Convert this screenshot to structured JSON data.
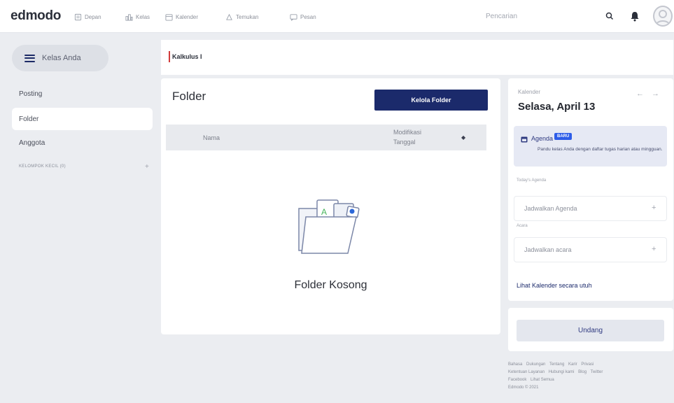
{
  "header": {
    "logo": "edmodo",
    "nav": [
      {
        "label": "Depan",
        "icon": "home-icon"
      },
      {
        "label": "Kelas",
        "icon": "class-icon"
      },
      {
        "label": "Kalender",
        "icon": "calendar-icon"
      },
      {
        "label": "Temukan",
        "icon": "discover-icon"
      },
      {
        "label": "Pesan",
        "icon": "message-icon"
      }
    ],
    "search_placeholder": "Pencarian"
  },
  "sidebar": {
    "class_toggle": "Kelas Anda",
    "items": [
      {
        "label": "Posting"
      },
      {
        "label": "Folder"
      },
      {
        "label": "Anggota"
      }
    ],
    "small_groups": "KELOMPOK KECIL (0)"
  },
  "class_banner": {
    "title": "Kalkulus I"
  },
  "folder": {
    "title": "Folder",
    "manage_button": "Kelola Folder",
    "col_name": "Nama",
    "col_modified": "Modifikasi Tanggal",
    "empty_text": "Folder Kosong"
  },
  "calendar": {
    "label": "Kalender",
    "date": "Selasa, April 13",
    "agenda_title": "Agenda",
    "agenda_badge": "BARU",
    "agenda_desc": "Pandu kelas Anda dengan daftar tugas harian atau mingguan.",
    "today_label": "Today's Agenda",
    "schedule_agenda": "Jadwalkan Agenda",
    "events_label": "Acara",
    "schedule_event": "Jadwalkan acara",
    "full_link": "Lihat Kalender secara utuh"
  },
  "invite": {
    "button": "Undang"
  },
  "footer": {
    "links": [
      "Bahasa",
      "Dukungan",
      "Tentang",
      "Karir",
      "Privasi",
      "Ketentuan Layanan",
      "Hubungi kami",
      "Blog",
      "Twitter",
      "Facebook",
      "Lihat Semua"
    ],
    "copyright": "Edmodo © 2021"
  },
  "colors": {
    "brand": "#1b2a6b",
    "accent_red": "#d23b3b",
    "badge": "#2d5ce8"
  }
}
